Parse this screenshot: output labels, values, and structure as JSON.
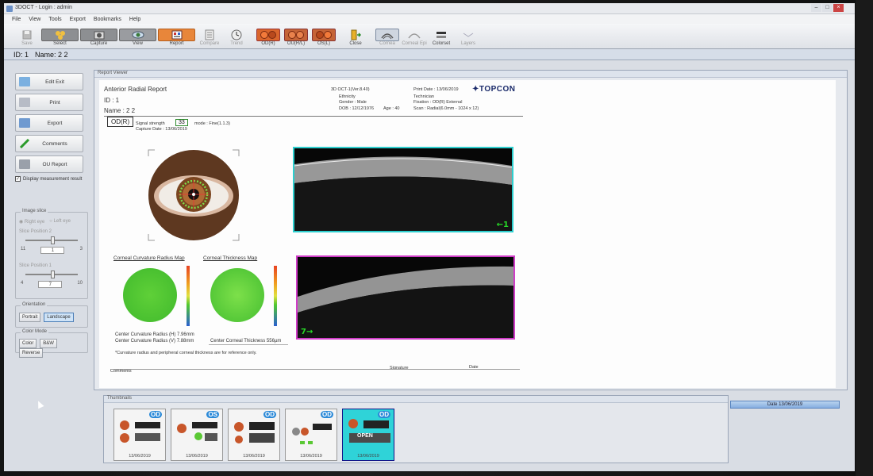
{
  "window": {
    "title": "3DOCT - Login : admin"
  },
  "menu": [
    "File",
    "View",
    "Tools",
    "Export",
    "Bookmarks",
    "Help"
  ],
  "toolbar": {
    "buttons": [
      {
        "label": "Save",
        "icon": "save-icon",
        "enabled": false
      },
      {
        "label": "Select",
        "icon": "select-icon",
        "enabled": true
      },
      {
        "label": "Capture",
        "icon": "capture-icon",
        "enabled": true
      },
      {
        "label": "View",
        "icon": "eye-icon",
        "enabled": true
      },
      {
        "label": "Report",
        "icon": "report-icon",
        "enabled": true,
        "selected": true
      },
      {
        "label": "Compare",
        "icon": "compare-icon",
        "enabled": false
      },
      {
        "label": "Trend",
        "icon": "clock-icon",
        "enabled": false
      },
      {
        "label": "OD(R)",
        "icon": "od-icon",
        "enabled": true,
        "selected": true
      },
      {
        "label": "OU(R/L)",
        "icon": "ou-icon",
        "enabled": true
      },
      {
        "label": "OS(L)",
        "icon": "os-icon",
        "enabled": true
      },
      {
        "label": "Close",
        "icon": "close-door-icon",
        "enabled": true
      },
      {
        "label": "Cornea",
        "icon": "cornea-icon",
        "enabled": false
      },
      {
        "label": "Corneal Epi",
        "icon": "corneal-epi-icon",
        "enabled": false
      },
      {
        "label": "Colorset",
        "icon": "colorset-icon",
        "enabled": true
      },
      {
        "label": "Layers",
        "icon": "layers-icon",
        "enabled": false
      }
    ]
  },
  "idbar": {
    "id": "ID: 1",
    "name": "Name: 2 2"
  },
  "leftpanel": {
    "buttons": [
      "Edit Exit",
      "Print",
      "Export",
      "Comments",
      "OU Report"
    ],
    "display_measurement": "Display measurement result",
    "image_slice": {
      "title": "Image slice",
      "right": "Right eye",
      "left": "Left eye",
      "pos2": {
        "label": "Slice Position 2",
        "min": "11",
        "value": "1",
        "max": "3"
      },
      "pos1": {
        "label": "Slice Position 1",
        "min": "4",
        "value": "7",
        "max": "10"
      }
    },
    "orientation": {
      "title": "Orientation",
      "portrait": "Portrait",
      "landscape": "Landscape"
    },
    "color_mode": {
      "title": "Color Mode",
      "color": "Color",
      "bw": "B&W",
      "reverse": "Reverse"
    }
  },
  "report": {
    "panel_title": "Report Viewer",
    "title": "Anterior Radial Report",
    "id": "ID : 1",
    "name": "Name : 2 2",
    "version": "3D OCT-1(Ver.8.40)",
    "ethnicity": "Ethnicity",
    "gender": "Gender : Male",
    "dob": "DOB : 12/12/1976",
    "age": "Age : 40",
    "print_date": "Print Date : 13/06/2019",
    "technician": "Technician",
    "fixation": "Fixation : OD(R) External",
    "scan": "Scan : Radial(6.0mm - 1024 x 12)",
    "brand": "TOPCON",
    "eye": "OD(R)",
    "signal_label": "Signal strength",
    "signal_value": "33",
    "mode": "mode : Fine(1.1.3)",
    "capture_date": "Capture Date : 13/06/2019",
    "map1_title": "Corneal Curvature Radius Map",
    "map2_title": "Corneal Thickness Map",
    "ccr_h": "Center Curvature Radius (H)   7.96mm",
    "ccr_v": "Center Curvature Radius (V)   7.88mm",
    "cct": "Center Corneal Thickness   556µm",
    "note": "*Curvature radius and peripheral corneal thickness are for reference only.",
    "comments": "Comments",
    "signature": "Signature",
    "date": "Date",
    "scan1_label": "1",
    "scan2_label": "7"
  },
  "thumbnails": {
    "title": "Thumbnails",
    "date_header": "Date 13/06/2019",
    "items": [
      {
        "eye": "OD",
        "date": "13/06/2019"
      },
      {
        "eye": "OS",
        "date": "13/06/2019"
      },
      {
        "eye": "OD",
        "date": "13/06/2019"
      },
      {
        "eye": "OD",
        "date": "13/06/2019"
      },
      {
        "eye": "OD",
        "date": "13/06/2019",
        "overlay": "OPEN"
      }
    ]
  }
}
